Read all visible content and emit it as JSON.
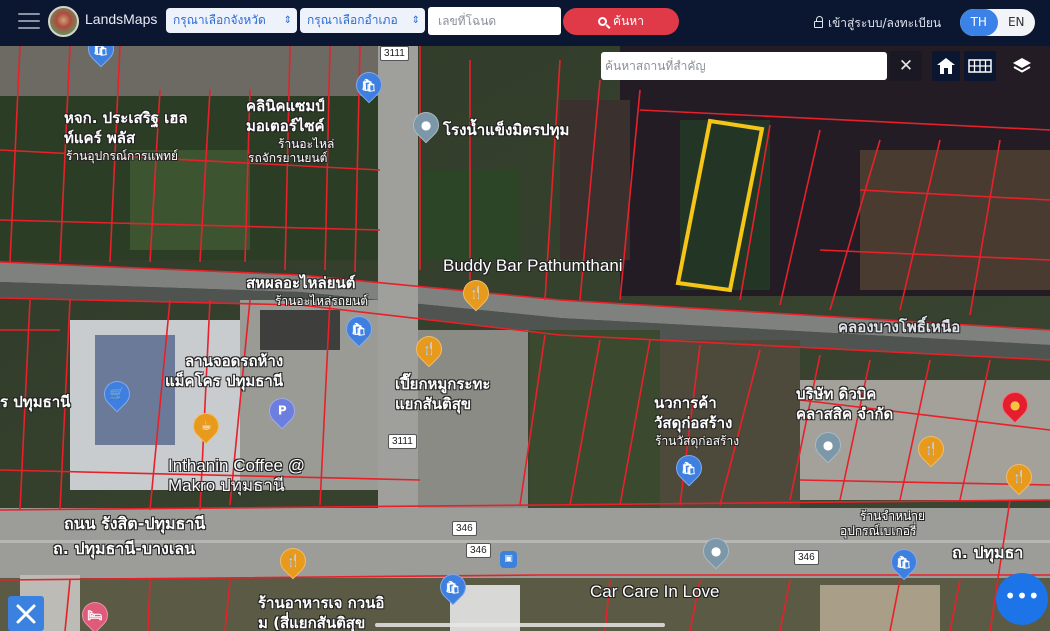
{
  "header": {
    "brand": "LandsMaps",
    "province_select": "กรุณาเลือกจังหวัด",
    "district_select": "กรุณาเลือกอำเภอ",
    "deed_placeholder": "เลขที่โฉนด",
    "search_label": "ค้นหา",
    "login_label": "เข้าสู่ระบบ/ลงทะเบียน",
    "lang_th": "TH",
    "lang_en": "EN",
    "updown_glyph": "⇕"
  },
  "map_tools": {
    "place_search_placeholder": "ค้นหาสถานที่สำคัญ",
    "clear_glyph": "✕",
    "fab_glyph": "•••"
  },
  "colors": {
    "parcel_line": "#e8202a",
    "highlight": "#f5c518",
    "header_bg": "#0b1631",
    "accent_red": "#e03a48",
    "accent_blue": "#3a82e8"
  },
  "labels": [
    {
      "text": "หจก. ประเสริฐ เฮล",
      "cls": ""
    },
    {
      "text": "ท์แคร์ พลัส",
      "cls": ""
    },
    {
      "text": "ร้านอุปกรณ์การแพทย์",
      "cls": "small"
    },
    {
      "text": "คลินิคแซมป์",
      "cls": ""
    },
    {
      "text": "มอเตอร์ไซค์",
      "cls": ""
    },
    {
      "text": "ร้านอะไหล่",
      "cls": "small"
    },
    {
      "text": "รถจักรยานยนต์",
      "cls": "small"
    },
    {
      "text": "โรงน้ำแข็งมิตรปทุม",
      "cls": ""
    },
    {
      "text": "Buddy Bar Pathumthani",
      "cls": "en"
    },
    {
      "text": "สหผลอะไหล่ยนต์",
      "cls": ""
    },
    {
      "text": "ร้านอะไหล่รถยนต์",
      "cls": "small"
    },
    {
      "text": "คลองบางโพธิ์เหนือ",
      "cls": ""
    },
    {
      "text": "ลานจอดรถห้าง",
      "cls": ""
    },
    {
      "text": "แม็คโคร ปทุมธานี",
      "cls": ""
    },
    {
      "text": "ร ปทุมธานี",
      "cls": ""
    },
    {
      "text": "เปี๊ยกหมูกระทะ",
      "cls": ""
    },
    {
      "text": "แยกสันติสุข",
      "cls": ""
    },
    {
      "text": "นวการค้า",
      "cls": ""
    },
    {
      "text": "วัสดุก่อสร้าง",
      "cls": ""
    },
    {
      "text": "ร้านวัสดุก่อสร้าง",
      "cls": "small"
    },
    {
      "text": "บริษัท ดิวบิค",
      "cls": ""
    },
    {
      "text": "คลาสสิค จำกัด",
      "cls": ""
    },
    {
      "text": "Inthanin Coffee @",
      "cls": "en"
    },
    {
      "text": "Makro ปทุมธานี",
      "cls": "en"
    },
    {
      "text": "ถนน รังสิต-ปทุมธานี",
      "cls": ""
    },
    {
      "text": "ถ. ปทุมธานี-บางเลน",
      "cls": ""
    },
    {
      "text": "ร้านจำหน่าย",
      "cls": "small"
    },
    {
      "text": "อุปกรณ์เบเกอรี่",
      "cls": "small"
    },
    {
      "text": "ถ. ปทุมธา",
      "cls": ""
    },
    {
      "text": "Car Care In Love",
      "cls": "en"
    },
    {
      "text": "ร้านอาหารเจ กวนอิ",
      "cls": ""
    },
    {
      "text": "ม (สี่แยกสันติสุข",
      "cls": ""
    }
  ],
  "road_shields": [
    "3111",
    "3111",
    "346",
    "346",
    "346"
  ],
  "pins": [
    {
      "type": "shopping",
      "glyph": "🛍"
    },
    {
      "type": "place",
      "glyph": "●"
    },
    {
      "type": "restaurant",
      "glyph": "🍴"
    },
    {
      "type": "shopping",
      "glyph": "🛍"
    },
    {
      "type": "restaurant",
      "glyph": "🍴"
    },
    {
      "type": "supermarket",
      "glyph": "🛒"
    },
    {
      "type": "cafe",
      "glyph": "☕"
    },
    {
      "type": "parking",
      "glyph": "P"
    },
    {
      "type": "shopping",
      "glyph": "🛍"
    },
    {
      "type": "place",
      "glyph": "●"
    },
    {
      "type": "restaurant",
      "glyph": "🍴"
    },
    {
      "type": "selected",
      "glyph": "●"
    },
    {
      "type": "restaurant",
      "glyph": "🍴"
    },
    {
      "type": "place",
      "glyph": "●"
    },
    {
      "type": "shopping",
      "glyph": "🛍"
    },
    {
      "type": "restaurant",
      "glyph": "🍴"
    },
    {
      "type": "hotel",
      "glyph": "🛏"
    },
    {
      "type": "shopping",
      "glyph": "🛍"
    }
  ]
}
